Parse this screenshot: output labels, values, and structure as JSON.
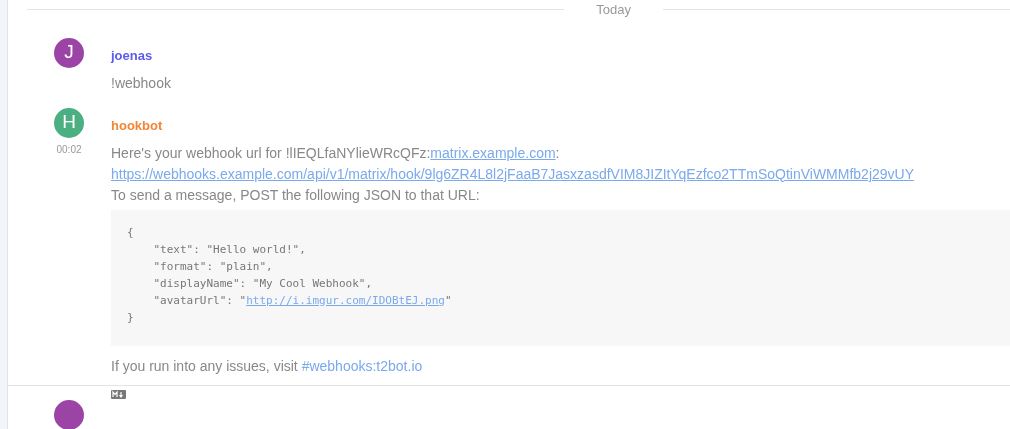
{
  "date_divider": "Today",
  "messages": [
    {
      "sender": {
        "text": "joenas",
        "color": "#5b5bf0"
      },
      "initial": "J",
      "color": "#9c44a5",
      "blocks": [
        {
          "kind": "paragraph",
          "segments": [
            {
              "kind": "text",
              "text": "!webhook"
            }
          ]
        }
      ]
    },
    {
      "sender": {
        "text": "hookbot",
        "color": "#f28535"
      },
      "initial": "H",
      "color": "#4caf82",
      "time": "00:02",
      "blocks": [
        {
          "kind": "paragraph",
          "segments": [
            {
              "kind": "text",
              "text": "Here's your webhook url for !lIEQLfaNYlieWRcQFz:"
            },
            {
              "kind": "link",
              "text": "matrix.example.com"
            },
            {
              "kind": "text",
              "text": ":"
            }
          ]
        },
        {
          "kind": "paragraph",
          "segments": [
            {
              "kind": "link",
              "text": "https://webhooks.example.com/api/v1/matrix/hook/9lg6ZR4L8l2jFaaB7JasxzasdfVIM8JIZItYqEzfco2TTmSoQtinViWMMfb2j29vUY"
            }
          ]
        },
        {
          "kind": "paragraph",
          "segments": [
            {
              "kind": "text",
              "text": "To send a message, POST the following JSON to that URL:"
            }
          ]
        },
        {
          "kind": "code",
          "lines": [
            [
              {
                "kind": "text",
                "text": "{"
              }
            ],
            [
              {
                "kind": "text",
                "text": "    \"text\": \"Hello world!\","
              }
            ],
            [
              {
                "kind": "text",
                "text": "    \"format\": \"plain\","
              }
            ],
            [
              {
                "kind": "text",
                "text": "    \"displayName\": \"My Cool Webhook\","
              }
            ],
            [
              {
                "kind": "text",
                "text": "    \"avatarUrl\": \""
              },
              {
                "kind": "link",
                "text": "http://i.imgur.com/IDOBtEJ.png"
              },
              {
                "kind": "text",
                "text": "\""
              }
            ],
            [
              {
                "kind": "text",
                "text": "}"
              }
            ]
          ]
        },
        {
          "kind": "paragraph",
          "segments": [
            {
              "kind": "text",
              "text": "If you run into any issues, visit "
            },
            {
              "kind": "room",
              "text": "#webhooks:t2bot.io"
            }
          ]
        }
      ]
    }
  ],
  "composer": {
    "avatar": {
      "color": "#9c44a5"
    }
  }
}
